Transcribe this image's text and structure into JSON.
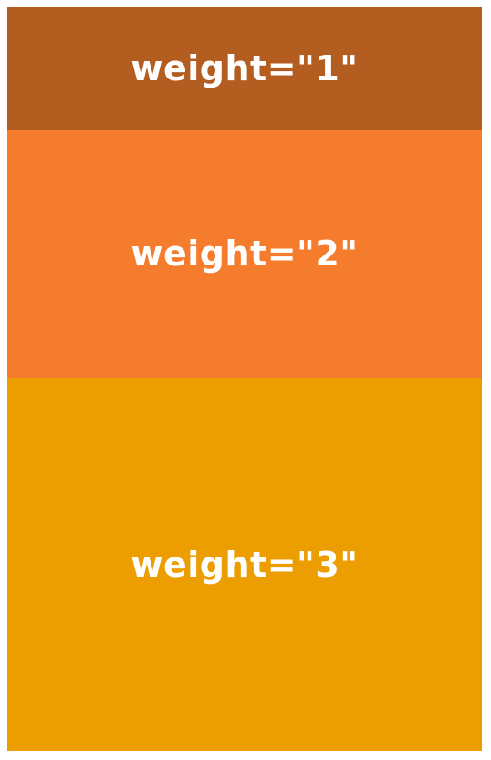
{
  "panels": [
    {
      "label": "weight=\"1\"",
      "weight": 1,
      "color": "#b45d20"
    },
    {
      "label": "weight=\"2\"",
      "weight": 2,
      "color": "#f57c2c"
    },
    {
      "label": "weight=\"3\"",
      "weight": 3,
      "color": "#ec9d00"
    }
  ]
}
